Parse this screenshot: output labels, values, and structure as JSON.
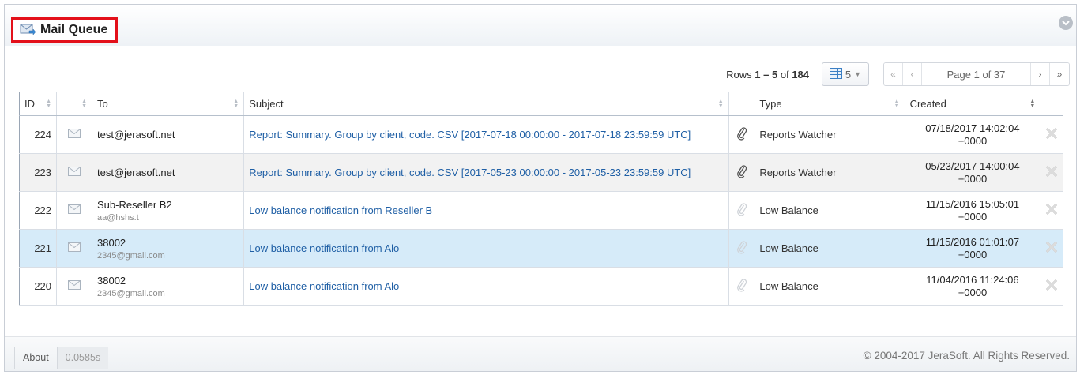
{
  "panel": {
    "title": "Mail Queue",
    "title_icon": "mail-send-icon",
    "collapse_icon": "collapse-circle-icon"
  },
  "toolbar": {
    "rows_prefix": "Rows",
    "rows_range": "1 – 5",
    "rows_of": "of",
    "rows_total": "184",
    "per_page": "5",
    "page_label": "Page 1 of 37",
    "first_icon": "«",
    "prev_icon": "‹",
    "next_icon": "›",
    "last_icon": "»"
  },
  "table": {
    "columns": [
      "ID",
      "",
      "To",
      "Subject",
      "",
      "Type",
      "Created",
      ""
    ],
    "rows": [
      {
        "id": "224",
        "to_name": "test@jerasoft.net",
        "to_email": "",
        "subject": "Report: Summary. Group by client, code. CSV [2017-07-18 00:00:00 - 2017-07-18 23:59:59 UTC]",
        "attachment": true,
        "type": "Reports Watcher",
        "created_date": "07/18/2017 14:02:04",
        "created_tz": "+0000"
      },
      {
        "id": "223",
        "to_name": "test@jerasoft.net",
        "to_email": "",
        "subject": "Report: Summary. Group by client, code. CSV [2017-05-23 00:00:00 - 2017-05-23 23:59:59 UTC]",
        "attachment": true,
        "type": "Reports Watcher",
        "created_date": "05/23/2017 14:00:04",
        "created_tz": "+0000"
      },
      {
        "id": "222",
        "to_name": "Sub-Reseller B2",
        "to_email": "aa@hshs.t",
        "subject": "Low balance notification from Reseller B",
        "attachment": false,
        "type": "Low Balance",
        "created_date": "11/15/2016 15:05:01",
        "created_tz": "+0000"
      },
      {
        "id": "221",
        "to_name": "38002",
        "to_email": "2345@gmail.com",
        "subject": "Low balance notification from Alo",
        "attachment": false,
        "type": "Low Balance",
        "created_date": "11/15/2016 01:01:07",
        "created_tz": "+0000"
      },
      {
        "id": "220",
        "to_name": "38002",
        "to_email": "2345@gmail.com",
        "subject": "Low balance notification from Alo",
        "attachment": false,
        "type": "Low Balance",
        "created_date": "11/04/2016 11:24:06",
        "created_tz": "+0000"
      }
    ]
  },
  "footer": {
    "about": "About",
    "time": "0.0585s",
    "copyright": "© 2004-2017 JeraSoft. All Rights Reserved."
  },
  "colors": {
    "highlight_border": "#e3101a",
    "link": "#1f5fa5",
    "selected_row": "#d6ebf9"
  }
}
